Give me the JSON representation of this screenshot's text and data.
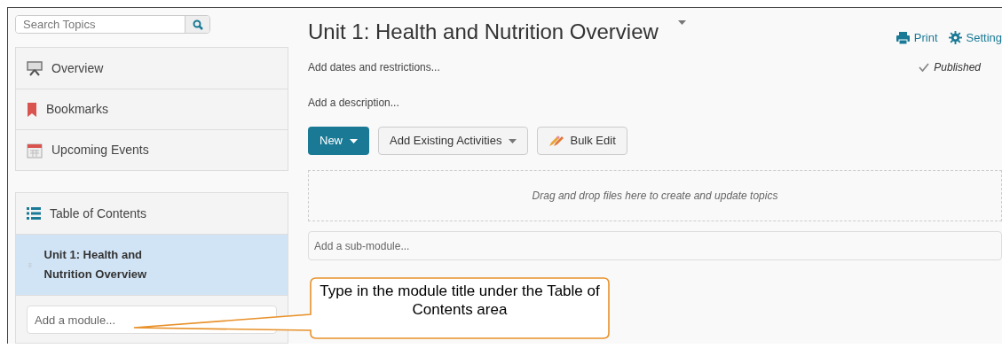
{
  "search": {
    "placeholder": "Search Topics"
  },
  "nav": [
    {
      "label": "Overview",
      "kind": "overview"
    },
    {
      "label": "Bookmarks",
      "kind": "bookmark"
    },
    {
      "label": "Upcoming Events",
      "kind": "calendar"
    }
  ],
  "toc": {
    "title": "Table of Contents",
    "modules": [
      {
        "label": "Unit 1: Health and Nutrition Overview",
        "selected": true
      }
    ],
    "add_placeholder": "Add a module..."
  },
  "main": {
    "title": "Unit 1: Health and Nutrition Overview",
    "actions": [
      {
        "label": "Print",
        "kind": "print"
      },
      {
        "label": "Setting",
        "kind": "settings"
      }
    ],
    "dates_link": "Add dates and restrictions...",
    "published": true,
    "status": "Published",
    "description_link": "Add a description...",
    "buttons": [
      {
        "label": "New",
        "kind": "primary"
      },
      {
        "label": "Add Existing Activities",
        "kind": "dropdown"
      },
      {
        "label": "Bulk Edit",
        "kind": "bulk"
      }
    ],
    "dropzone": "Drag and drop files here to create and update topics",
    "submodule_placeholder": "Add a sub-module..."
  },
  "callout": "Type in the module title under the Table of Contents area"
}
